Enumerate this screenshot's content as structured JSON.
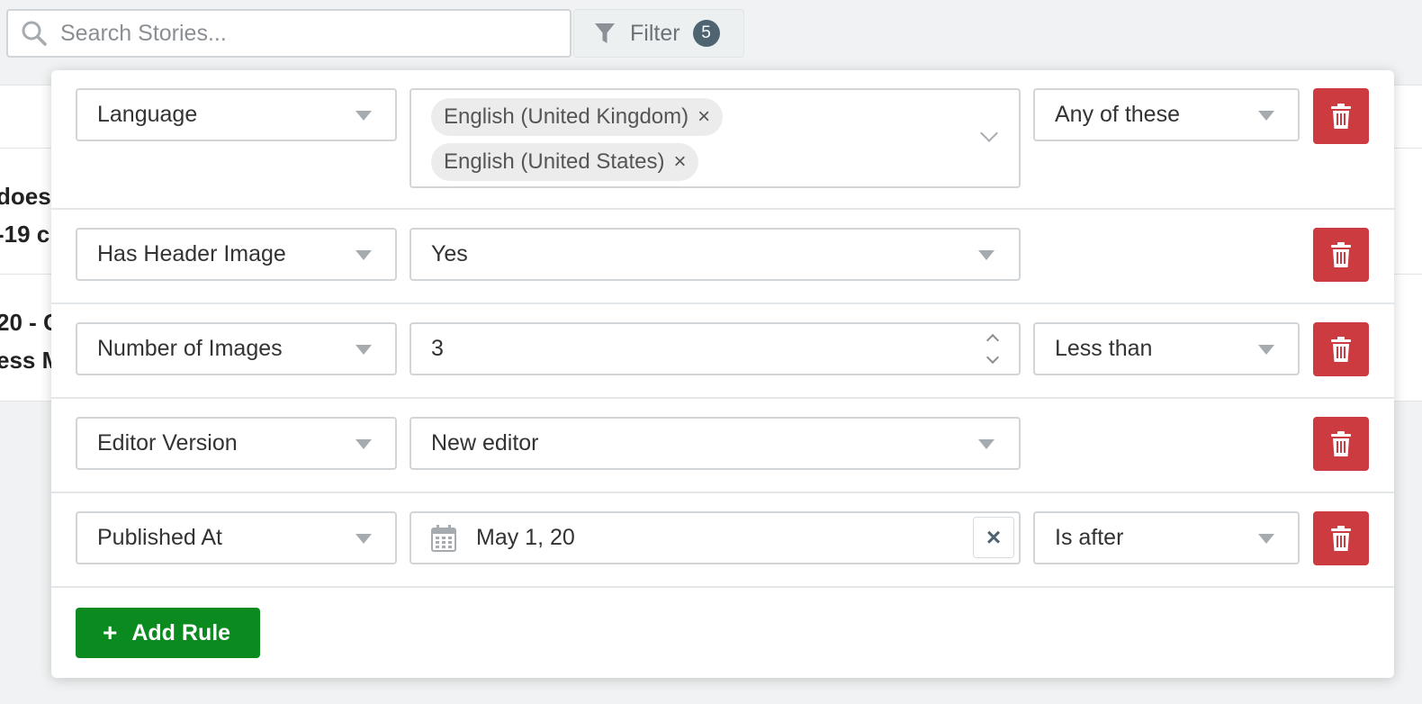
{
  "search": {
    "placeholder": "Search Stories..."
  },
  "filter_button": {
    "label": "Filter",
    "count": "5"
  },
  "background_rows": [
    {
      "line1": "does",
      "line2": "-19 c"
    },
    {
      "line1": "20 - C",
      "line2": "ess M"
    }
  ],
  "rules": [
    {
      "field": "Language",
      "values": [
        "English (United Kingdom)",
        "English (United States)"
      ],
      "operator": "Any of these"
    },
    {
      "field": "Has Header Image",
      "value": "Yes"
    },
    {
      "field": "Number of Images",
      "value": "3",
      "operator": "Less than"
    },
    {
      "field": "Editor Version",
      "value": "New editor"
    },
    {
      "field": "Published At",
      "value": "May 1, 20",
      "operator": "Is after"
    }
  ],
  "add_rule": {
    "plus": "+",
    "label": "Add Rule"
  },
  "icons": {
    "tag_remove": "×",
    "clear": "×"
  },
  "colors": {
    "delete": "#cb3b3f",
    "add": "#0b8a20",
    "badge": "#4e6471"
  }
}
